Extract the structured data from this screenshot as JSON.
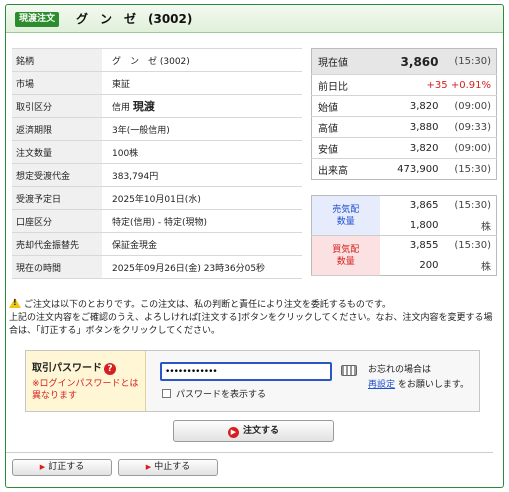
{
  "header": {
    "badge": "現渡注文",
    "title": "グ　ン　ゼ　(3002)"
  },
  "order": [
    {
      "label": "銘柄",
      "value": "グ　ン　ゼ (3002)"
    },
    {
      "label": "市場",
      "value": "東証"
    },
    {
      "label": "取引区分",
      "prefix": "信用",
      "value": "現渡"
    },
    {
      "label": "返済期限",
      "value": "3年(一般信用)"
    },
    {
      "label": "注文数量",
      "value": "100株"
    },
    {
      "label": "想定受渡代金",
      "value": "383,794円"
    },
    {
      "label": "受渡予定日",
      "value": "2025年10月01日(水)"
    },
    {
      "label": "口座区分",
      "value": "特定(信用) - 特定(現物)"
    },
    {
      "label": "売却代金振替先",
      "value": "保証金現金"
    },
    {
      "label": "現在の時間",
      "value": "2025年09月26日(金) 23時36分05秒"
    }
  ],
  "quote": {
    "current": {
      "label": "現在値",
      "value": "3,860",
      "time": "(15:30)"
    },
    "change": {
      "label": "前日比",
      "value": "+35",
      "pct": "+0.91%"
    },
    "rows": [
      {
        "label": "始値",
        "value": "3,820",
        "time": "(09:00)"
      },
      {
        "label": "高値",
        "value": "3,880",
        "time": "(09:33)"
      },
      {
        "label": "安値",
        "value": "3,820",
        "time": "(09:00)"
      },
      {
        "label": "出来高",
        "value": "473,900",
        "time": "(15:30)"
      }
    ]
  },
  "board": {
    "sell": {
      "label1": "売気配",
      "label2": "数量",
      "price": "3,865",
      "time": "(15:30)",
      "qty": "1,800",
      "unit": "株"
    },
    "buy": {
      "label1": "買気配",
      "label2": "数量",
      "price": "3,855",
      "time": "(15:30)",
      "qty": "200",
      "unit": "株"
    }
  },
  "notice": {
    "line1": "ご注文は以下のとおりです。この注文は、私の判断と責任により注文を委託するものです。",
    "line2": "上記の注文内容をご確認のうえ、よろしければ[注文する]ボタンをクリックしてください。なお、注文内容を変更する場合は、「訂正する」ボタンをクリックしてください。"
  },
  "password": {
    "label": "取引パスワード",
    "help": "?",
    "note": "※ログインパスワードとは異なります",
    "value": "••••••••••••",
    "show_label": "パスワードを表示する",
    "forgot_pre": "お忘れの場合は",
    "forgot_link": "再設定",
    "forgot_post": "をお願いします。"
  },
  "buttons": {
    "submit": "注文する",
    "correct": "訂正する",
    "cancel": "中止する"
  },
  "colors": {
    "accent_green": "#2d8c2d",
    "up_red": "#d62020",
    "sell_blue": "#1f4fd1"
  }
}
